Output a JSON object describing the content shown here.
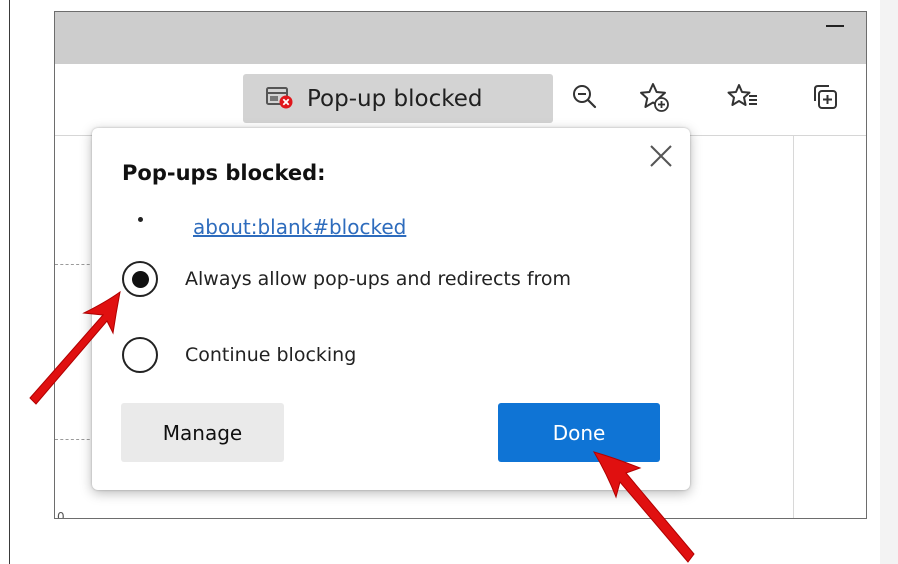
{
  "toolbar": {
    "popup_blocked_label": "Pop-up blocked",
    "icons": [
      "popup-blocked-icon",
      "zoom-out-icon",
      "add-favorite-icon",
      "favorites-list-icon",
      "collections-icon"
    ]
  },
  "dialog": {
    "title": "Pop-ups blocked:",
    "blocked_items": [
      "about:blank#blocked"
    ],
    "options": [
      {
        "label": "Always allow pop-ups and redirects from",
        "selected": true
      },
      {
        "label": "Continue blocking",
        "selected": false
      }
    ],
    "manage_label": "Manage",
    "done_label": "Done"
  },
  "page": {
    "axis_zero": "0"
  },
  "colors": {
    "accent": "#0f74d5",
    "link": "#2e6cbd",
    "annotation_arrow": "#e01010",
    "blocked_badge": "#e0161b"
  }
}
